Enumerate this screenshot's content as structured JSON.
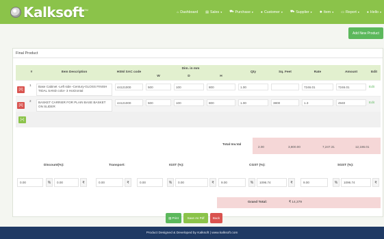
{
  "brand": {
    "name": "Kalksoft",
    "tm": "TM"
  },
  "nav": [
    {
      "label": "Dashboard",
      "icon": "home-icon",
      "glyph": "⌂",
      "dropdown": false
    },
    {
      "label": "Sales",
      "icon": "list-icon",
      "glyph": "▤",
      "dropdown": true
    },
    {
      "label": "Purchase",
      "icon": "cart-icon",
      "glyph": "⛟",
      "dropdown": true
    },
    {
      "label": "Customer",
      "icon": "user-icon",
      "glyph": "●",
      "dropdown": true
    },
    {
      "label": "Supplier",
      "icon": "cart-icon",
      "glyph": "⛟",
      "dropdown": true
    },
    {
      "label": "Item",
      "icon": "gear-icon",
      "glyph": "✹",
      "dropdown": true
    },
    {
      "label": "Report",
      "icon": "chart-icon",
      "glyph": "▭",
      "dropdown": true
    },
    {
      "label": "Hello",
      "icon": "user-icon",
      "glyph": "●",
      "dropdown": true
    }
  ],
  "add_new_label": "Add New Product",
  "panel_title": "Final Product",
  "table": {
    "headers": {
      "num": "#",
      "desc": "Item Description",
      "hsn": "HSN/ SAC code",
      "dim": "Dim. in mm",
      "w": "W",
      "d": "D",
      "h": "H",
      "qty": "Qty",
      "sqft": "Sq. Feet",
      "rate": "Rate",
      "amount": "Amount",
      "edit": "Edit"
    },
    "rows": [
      {
        "del_label": "[X]",
        "num": "1",
        "desc": "Base Cabinet -Left side -Century-GLOSS FINISH TIDAL SAND color- 3 Horizontal",
        "hsn": "44121000",
        "w": "500",
        "d": "100",
        "h": "800",
        "qty": "1.00",
        "sqft": "",
        "rate": "7246.01",
        "amount": "7246.01",
        "edit": "Edit"
      },
      {
        "del_label": "[X]",
        "num": "2",
        "desc": "BASKET CARRIER FOR PLAIN BASE BASKET ON SLIDER",
        "hsn": "44121000",
        "w": "500",
        "d": "100",
        "h": "800",
        "qty": "1.00",
        "sqft": "3800",
        "rate": "1.3",
        "amount": "4940",
        "edit": "Edit"
      }
    ],
    "add_label": "[+]"
  },
  "totals": {
    "label": "Total Inv.Val",
    "qty": "2.00",
    "sqft": "3,800.00",
    "rate": "7,247.31",
    "amount": "12,186.01"
  },
  "tax": {
    "discount_label": "Discount(%):",
    "transport_label": "Transport:",
    "igst_label": "IGST (%):",
    "cgst_label": "CGST (%):",
    "sgst_label": "SGST (%):",
    "discount_pct": "0.00",
    "discount_amt": "0.00",
    "transport_amt": "0.00",
    "igst_pct": "0.00",
    "igst_amt": "0.00",
    "cgst_pct": "9.00",
    "cgst_amt": "1096.74",
    "sgst_pct": "9.00",
    "sgst_amt": "1096.74",
    "pct_symbol": "%",
    "currency_symbol": "₹"
  },
  "grand_total": {
    "label": "Grand Total:",
    "value": "₹ 14,379"
  },
  "actions": {
    "print": "Print",
    "print_icon": "printer-icon",
    "save_pdf": "Save As Pdf",
    "back": "Back"
  },
  "footer": "Product Designed & Developed by Kalksoft | www.kalksoft.com",
  "colors": {
    "nav": "#8bc34a",
    "header_cell": "#e2f0cf",
    "danger": "#d9534f",
    "success": "#5cb85c",
    "highlight": "#f5d7d7",
    "footer": "#1f3a64"
  }
}
